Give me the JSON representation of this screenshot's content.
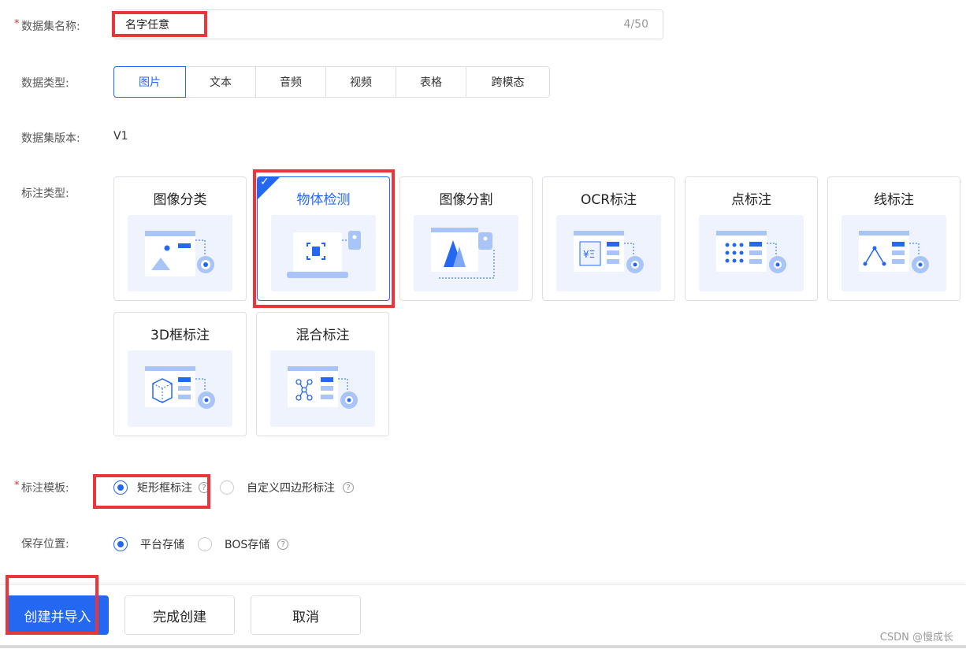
{
  "form": {
    "name_label": "数据集名称:",
    "name_value": "名字任意",
    "name_count": "4/50",
    "type_label": "数据类型:",
    "types": [
      "图片",
      "文本",
      "音频",
      "视频",
      "表格",
      "跨模态"
    ],
    "active_type": "图片",
    "version_label": "数据集版本:",
    "version_value": "V1",
    "annotation_label": "标注类型:",
    "annotation_types": [
      "图像分类",
      "物体检测",
      "图像分割",
      "OCR标注",
      "点标注",
      "线标注",
      "3D框标注",
      "混合标注"
    ],
    "active_annotation": "物体检测",
    "template_label": "标注模板:",
    "template_options": [
      "矩形框标注",
      "自定义四边形标注"
    ],
    "storage_label": "保存位置:",
    "storage_options": [
      "平台存储",
      "BOS存储"
    ]
  },
  "footer": {
    "create_import": "创建并导入",
    "finish": "完成创建",
    "cancel": "取消",
    "watermark": "CSDN @慢成长"
  },
  "icons": {
    "help": "help-circle-icon",
    "check": "check-icon",
    "tag": "tag-icon"
  },
  "colors": {
    "accent": "#2468f2",
    "highlight": "#e8363b",
    "illustration_bg": "#eef3fd"
  }
}
